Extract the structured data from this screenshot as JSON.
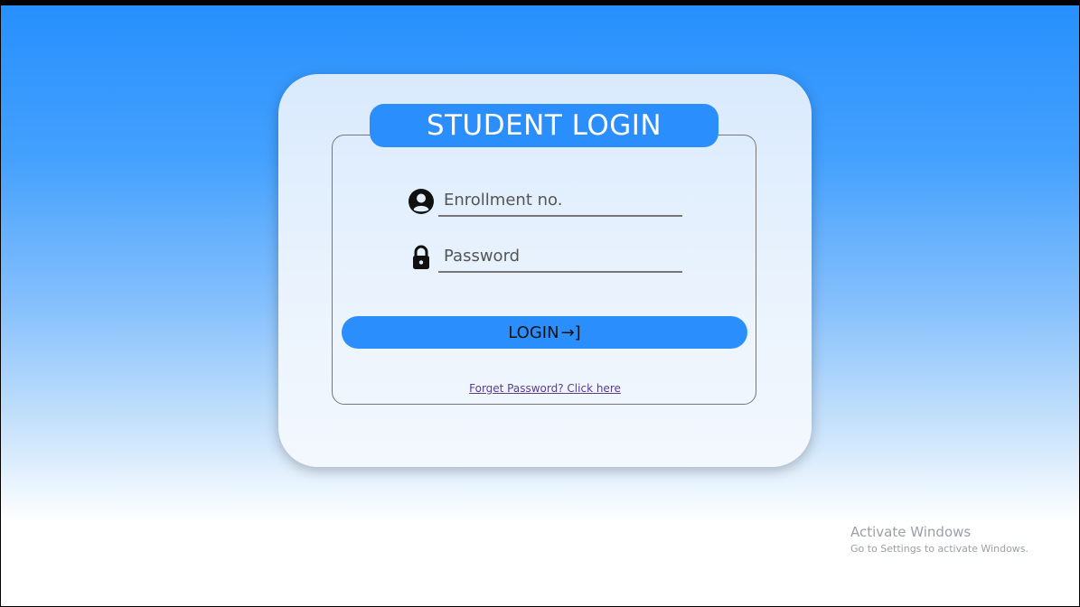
{
  "login_card": {
    "title": "STUDENT LOGIN",
    "enrollment": {
      "icon": "user-circle-icon",
      "placeholder": "Enrollment no.",
      "value": ""
    },
    "password": {
      "icon": "lock-icon",
      "placeholder": "Password",
      "value": ""
    },
    "login_button": {
      "label": "LOGIN",
      "icon": "sign-in-arrow-icon",
      "icon_glyph": "→]"
    },
    "forgot_link": "Forget Password? Click here"
  },
  "watermark": {
    "title": "Activate Windows",
    "subtitle": "Go to Settings to activate Windows."
  },
  "colors": {
    "accent": "#2a8ffc",
    "background_top": "#2790fd",
    "link": "#5a3e8f"
  }
}
